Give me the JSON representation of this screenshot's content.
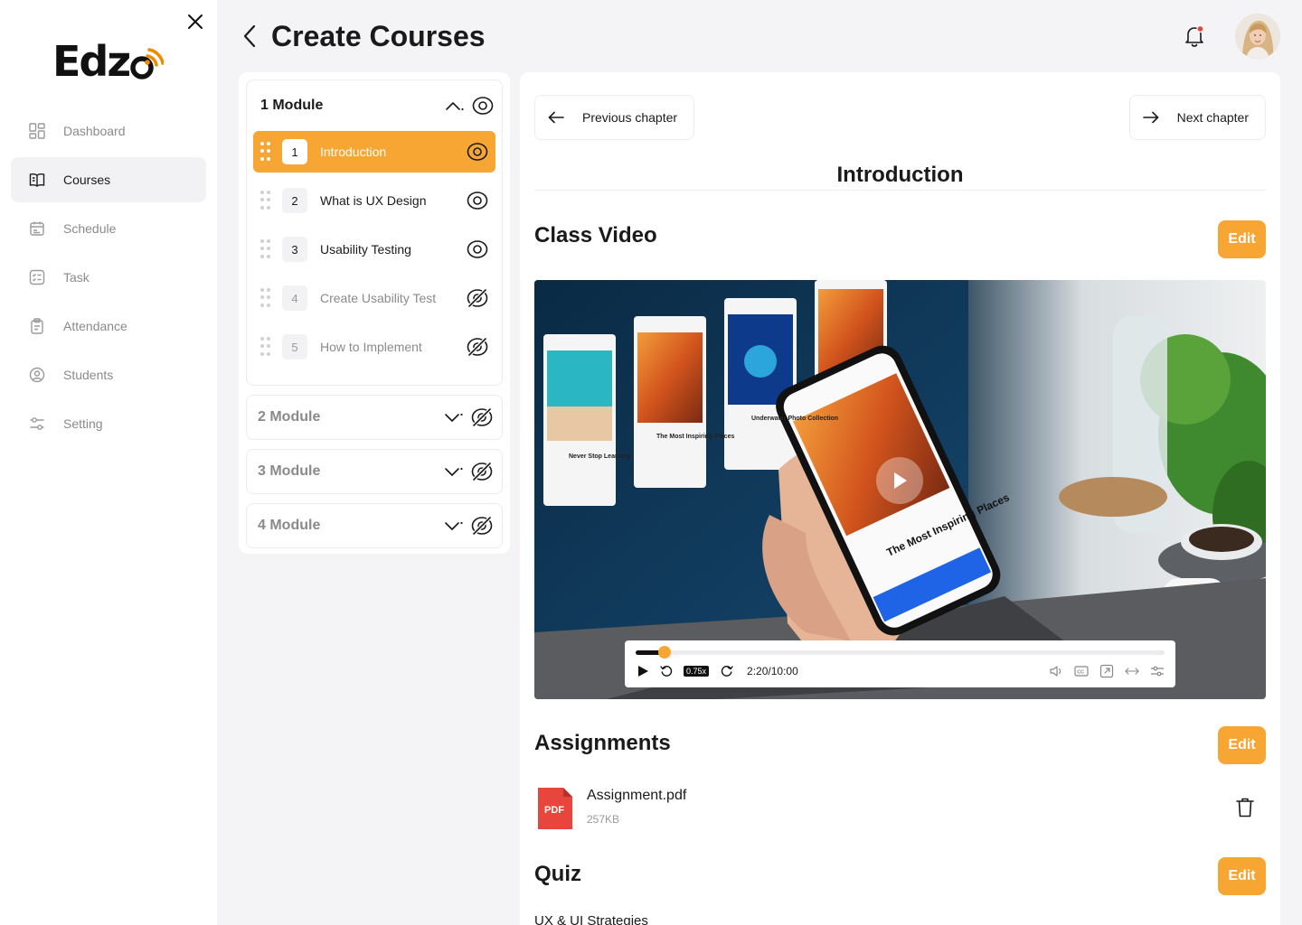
{
  "app": {
    "logo_text": "Edz"
  },
  "sidebar": {
    "items": [
      {
        "label": "Dashboard",
        "icon": "dashboard-icon"
      },
      {
        "label": "Courses",
        "icon": "book-icon"
      },
      {
        "label": "Schedule",
        "icon": "calendar-icon"
      },
      {
        "label": "Task",
        "icon": "task-icon"
      },
      {
        "label": "Attendance",
        "icon": "clipboard-icon"
      },
      {
        "label": "Students",
        "icon": "user-icon"
      },
      {
        "label": "Setting",
        "icon": "sliders-icon"
      }
    ],
    "active_index": 1
  },
  "header": {
    "title": "Create Courses"
  },
  "modules": [
    {
      "title": "1 Module",
      "expanded": true,
      "visible": true,
      "chapters": [
        {
          "num": "1",
          "label": "Introduction",
          "active": true,
          "visible": true
        },
        {
          "num": "2",
          "label": "What is UX Design",
          "active": false,
          "visible": true
        },
        {
          "num": "3",
          "label": "Usability Testing",
          "active": false,
          "visible": true
        },
        {
          "num": "4",
          "label": "Create Usability Test",
          "active": false,
          "visible": false
        },
        {
          "num": "5",
          "label": "How to Implement",
          "active": false,
          "visible": false
        }
      ]
    },
    {
      "title": "2 Module",
      "expanded": false,
      "visible": false
    },
    {
      "title": "3 Module",
      "expanded": false,
      "visible": false
    },
    {
      "title": "4 Module",
      "expanded": false,
      "visible": false
    }
  ],
  "content": {
    "prev_label": "Previous chapter",
    "next_label": "Next chapter",
    "chapter_title": "Introduction",
    "edit_label": "Edit",
    "sections": {
      "video": "Class Video",
      "assignments": "Assignments",
      "quiz": "Quiz"
    },
    "video": {
      "speed": "0.75x",
      "time": "2:20/10:00",
      "progress": 0.055,
      "phone_title": "The Most Inspiring Places",
      "card_labels": [
        "Never Stop Learning",
        "The Most Inspiring Places",
        "Underwater Photo Collection"
      ]
    },
    "assignment": {
      "name": "Assignment.pdf",
      "size": "257KB",
      "type_badge": "PDF"
    },
    "quiz_item": "UX & UI Strategies"
  },
  "colors": {
    "accent": "#f7a634",
    "pdf": "#e8453c"
  }
}
